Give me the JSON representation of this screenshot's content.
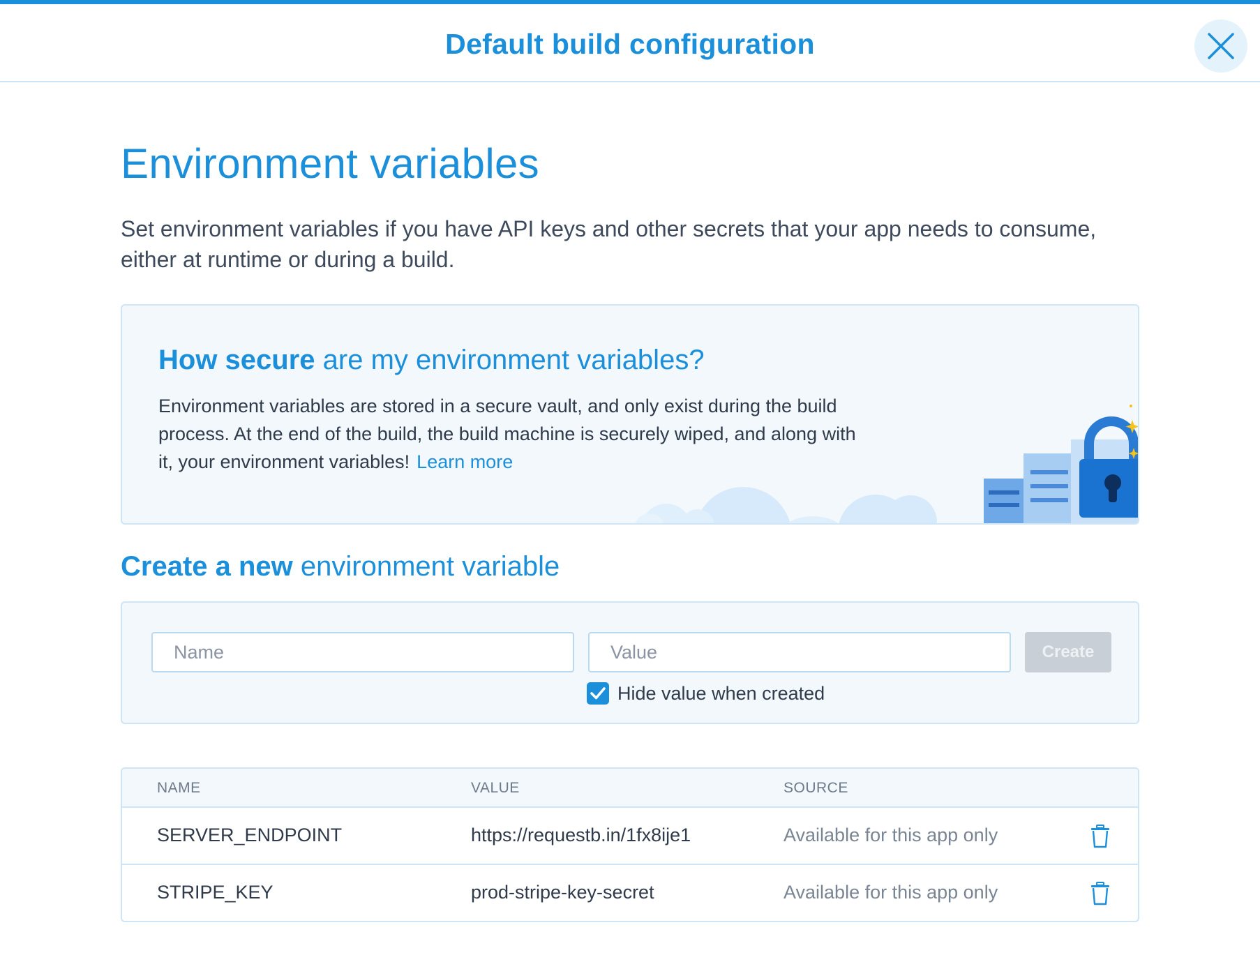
{
  "header": {
    "title": "Default build configuration"
  },
  "page": {
    "title": "Environment variables",
    "description": "Set environment variables if you have API keys and other secrets that your app needs to consume, either at runtime or during a build."
  },
  "info": {
    "heading_bold": "How secure",
    "heading_rest": " are my environment variables?",
    "text": "Environment variables are stored in a secure vault, and only exist during the build process. At the end of the build, the build machine is securely wiped, and along with it, your environment variables!",
    "link": "Learn more"
  },
  "create": {
    "heading_bold": "Create a new",
    "heading_rest": " environment variable",
    "name_placeholder": "Name",
    "value_placeholder": "Value",
    "button": "Create",
    "hide_label": "Hide value when created",
    "hide_checked": true
  },
  "table": {
    "headers": [
      "NAME",
      "VALUE",
      "SOURCE"
    ],
    "rows": [
      {
        "name": "SERVER_ENDPOINT",
        "value": "https://requestb.in/1fx8ije1",
        "source": "Available for this app only"
      },
      {
        "name": "STRIPE_KEY",
        "value": "prod-stripe-key-secret",
        "source": "Available for this app only"
      }
    ]
  },
  "icons": {
    "close": "close-icon",
    "check": "check-icon",
    "trash": "trash-icon",
    "lock": "lock-illustration"
  },
  "colors": {
    "accent": "#1b8fd9",
    "border": "#cfe5f5",
    "panel": "#f2f8fc",
    "disabled": "#c9cfd6"
  }
}
